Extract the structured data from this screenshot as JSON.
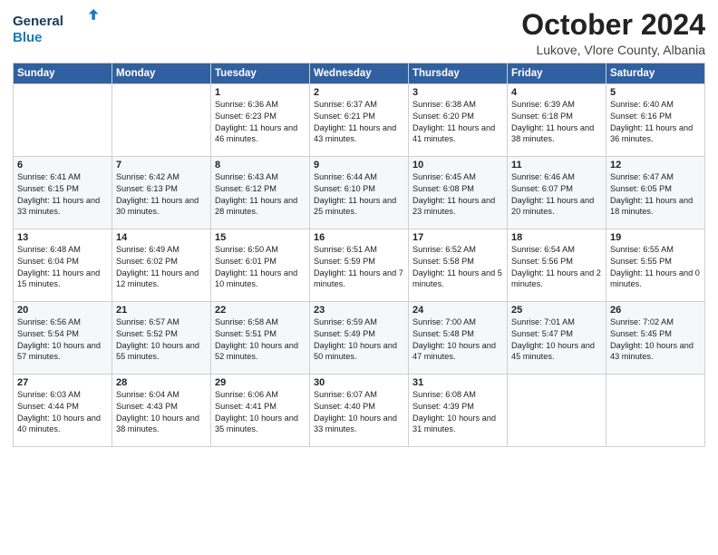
{
  "header": {
    "logo_line1": "General",
    "logo_line2": "Blue",
    "month": "October 2024",
    "location": "Lukove, Vlore County, Albania"
  },
  "days_of_week": [
    "Sunday",
    "Monday",
    "Tuesday",
    "Wednesday",
    "Thursday",
    "Friday",
    "Saturday"
  ],
  "weeks": [
    [
      {
        "day": "",
        "content": ""
      },
      {
        "day": "",
        "content": ""
      },
      {
        "day": "1",
        "content": "Sunrise: 6:36 AM\nSunset: 6:23 PM\nDaylight: 11 hours and 46 minutes."
      },
      {
        "day": "2",
        "content": "Sunrise: 6:37 AM\nSunset: 6:21 PM\nDaylight: 11 hours and 43 minutes."
      },
      {
        "day": "3",
        "content": "Sunrise: 6:38 AM\nSunset: 6:20 PM\nDaylight: 11 hours and 41 minutes."
      },
      {
        "day": "4",
        "content": "Sunrise: 6:39 AM\nSunset: 6:18 PM\nDaylight: 11 hours and 38 minutes."
      },
      {
        "day": "5",
        "content": "Sunrise: 6:40 AM\nSunset: 6:16 PM\nDaylight: 11 hours and 36 minutes."
      }
    ],
    [
      {
        "day": "6",
        "content": "Sunrise: 6:41 AM\nSunset: 6:15 PM\nDaylight: 11 hours and 33 minutes."
      },
      {
        "day": "7",
        "content": "Sunrise: 6:42 AM\nSunset: 6:13 PM\nDaylight: 11 hours and 30 minutes."
      },
      {
        "day": "8",
        "content": "Sunrise: 6:43 AM\nSunset: 6:12 PM\nDaylight: 11 hours and 28 minutes."
      },
      {
        "day": "9",
        "content": "Sunrise: 6:44 AM\nSunset: 6:10 PM\nDaylight: 11 hours and 25 minutes."
      },
      {
        "day": "10",
        "content": "Sunrise: 6:45 AM\nSunset: 6:08 PM\nDaylight: 11 hours and 23 minutes."
      },
      {
        "day": "11",
        "content": "Sunrise: 6:46 AM\nSunset: 6:07 PM\nDaylight: 11 hours and 20 minutes."
      },
      {
        "day": "12",
        "content": "Sunrise: 6:47 AM\nSunset: 6:05 PM\nDaylight: 11 hours and 18 minutes."
      }
    ],
    [
      {
        "day": "13",
        "content": "Sunrise: 6:48 AM\nSunset: 6:04 PM\nDaylight: 11 hours and 15 minutes."
      },
      {
        "day": "14",
        "content": "Sunrise: 6:49 AM\nSunset: 6:02 PM\nDaylight: 11 hours and 12 minutes."
      },
      {
        "day": "15",
        "content": "Sunrise: 6:50 AM\nSunset: 6:01 PM\nDaylight: 11 hours and 10 minutes."
      },
      {
        "day": "16",
        "content": "Sunrise: 6:51 AM\nSunset: 5:59 PM\nDaylight: 11 hours and 7 minutes."
      },
      {
        "day": "17",
        "content": "Sunrise: 6:52 AM\nSunset: 5:58 PM\nDaylight: 11 hours and 5 minutes."
      },
      {
        "day": "18",
        "content": "Sunrise: 6:54 AM\nSunset: 5:56 PM\nDaylight: 11 hours and 2 minutes."
      },
      {
        "day": "19",
        "content": "Sunrise: 6:55 AM\nSunset: 5:55 PM\nDaylight: 11 hours and 0 minutes."
      }
    ],
    [
      {
        "day": "20",
        "content": "Sunrise: 6:56 AM\nSunset: 5:54 PM\nDaylight: 10 hours and 57 minutes."
      },
      {
        "day": "21",
        "content": "Sunrise: 6:57 AM\nSunset: 5:52 PM\nDaylight: 10 hours and 55 minutes."
      },
      {
        "day": "22",
        "content": "Sunrise: 6:58 AM\nSunset: 5:51 PM\nDaylight: 10 hours and 52 minutes."
      },
      {
        "day": "23",
        "content": "Sunrise: 6:59 AM\nSunset: 5:49 PM\nDaylight: 10 hours and 50 minutes."
      },
      {
        "day": "24",
        "content": "Sunrise: 7:00 AM\nSunset: 5:48 PM\nDaylight: 10 hours and 47 minutes."
      },
      {
        "day": "25",
        "content": "Sunrise: 7:01 AM\nSunset: 5:47 PM\nDaylight: 10 hours and 45 minutes."
      },
      {
        "day": "26",
        "content": "Sunrise: 7:02 AM\nSunset: 5:45 PM\nDaylight: 10 hours and 43 minutes."
      }
    ],
    [
      {
        "day": "27",
        "content": "Sunrise: 6:03 AM\nSunset: 4:44 PM\nDaylight: 10 hours and 40 minutes."
      },
      {
        "day": "28",
        "content": "Sunrise: 6:04 AM\nSunset: 4:43 PM\nDaylight: 10 hours and 38 minutes."
      },
      {
        "day": "29",
        "content": "Sunrise: 6:06 AM\nSunset: 4:41 PM\nDaylight: 10 hours and 35 minutes."
      },
      {
        "day": "30",
        "content": "Sunrise: 6:07 AM\nSunset: 4:40 PM\nDaylight: 10 hours and 33 minutes."
      },
      {
        "day": "31",
        "content": "Sunrise: 6:08 AM\nSunset: 4:39 PM\nDaylight: 10 hours and 31 minutes."
      },
      {
        "day": "",
        "content": ""
      },
      {
        "day": "",
        "content": ""
      }
    ]
  ]
}
